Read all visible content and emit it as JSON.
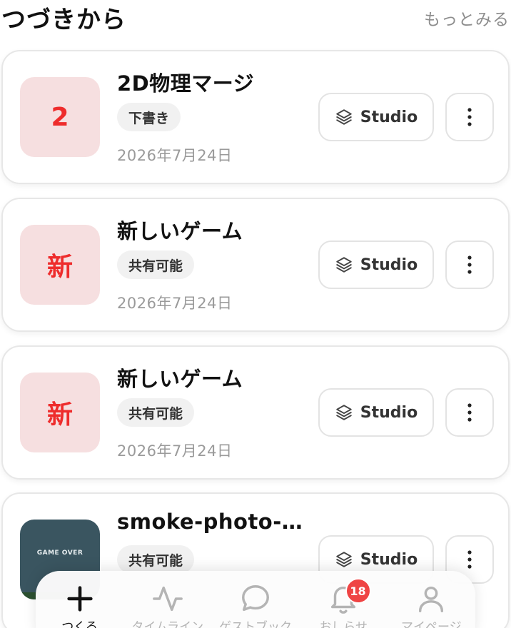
{
  "header": {
    "title": "つづきから",
    "more_link": "もっとみる"
  },
  "projects": [
    {
      "thumbnail_text": "2",
      "title": "2D物理マージ",
      "status": "下書き",
      "date": "2026年7月24日",
      "studio_label": "Studio"
    },
    {
      "thumbnail_text": "新",
      "title": "新しいゲーム",
      "status": "共有可能",
      "date": "2026年7月24日",
      "studio_label": "Studio"
    },
    {
      "thumbnail_text": "新",
      "title": "新しいゲーム",
      "status": "共有可能",
      "date": "2026年7月24日",
      "studio_label": "Studio"
    },
    {
      "thumbnail_text": "GAME OVER",
      "title": "smoke-photo-…",
      "status": "共有可能",
      "date": "",
      "studio_label": "Studio"
    }
  ],
  "tabbar": {
    "tabs": [
      {
        "label": "つくる",
        "icon": "plus-icon",
        "active": true
      },
      {
        "label": "タイムライン",
        "icon": "activity-icon",
        "active": false
      },
      {
        "label": "ゲストブック",
        "icon": "chat-bubble-icon",
        "active": false
      },
      {
        "label": "おしらせ",
        "icon": "bell-icon",
        "active": false,
        "badge": "18"
      },
      {
        "label": "マイページ",
        "icon": "user-icon",
        "active": false
      }
    ]
  },
  "colors": {
    "thumbnail_bg": "#f6dfe0",
    "thumbnail_text": "#ee2c2c",
    "badge_bg": "#f1f1f1",
    "notification_badge": "#ef4444"
  }
}
